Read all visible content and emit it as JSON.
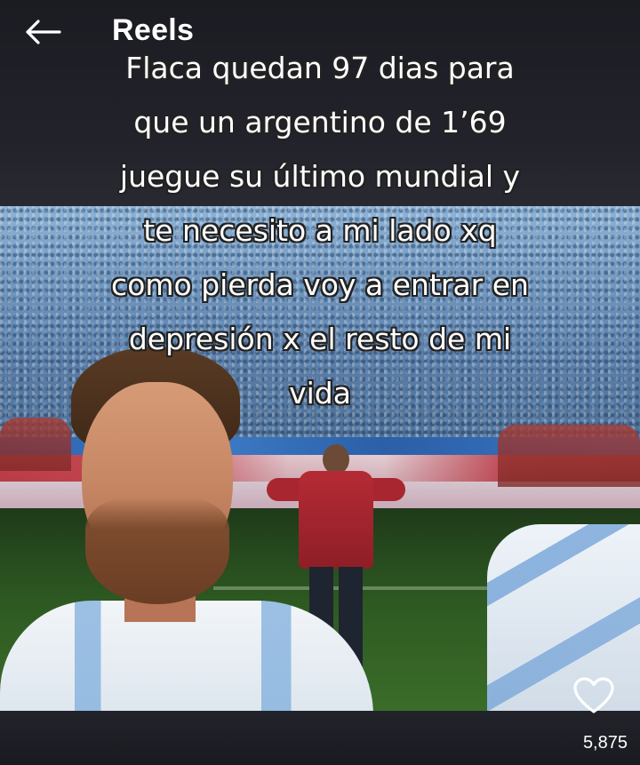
{
  "header": {
    "title": "Reels",
    "back_icon": "arrow-left-icon"
  },
  "video": {
    "caption": "Flaca quedan 97 dias para\nque un argentino de 1’69\njuegue su último mundial y\nte necesito a mi lado xq\ncomo pierda voy a entrar en\ndepresión x el resto de mi\nvida"
  },
  "actions": {
    "like_icon": "heart-outline-icon",
    "like_count": "5,875"
  },
  "colors": {
    "text": "#ffffff",
    "background": "#1d1d25"
  }
}
